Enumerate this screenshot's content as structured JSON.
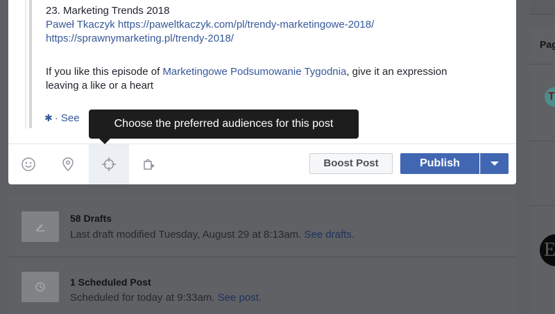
{
  "post": {
    "episode_title": "23. Marketing Trends 2018",
    "link_line_1": "Paweł Tkaczyk https://paweltkaczyk.com/pl/trendy-marketingowe-2018/",
    "link_line_2": "https://sprawnymarketing.pl/trendy-2018/",
    "desc_before": "If you like this episode of ",
    "desc_link": "Marketingowe Podsumowanie Tygodnia",
    "desc_after": ", give it an expression leaving a like or a heart",
    "see_more": "See"
  },
  "tooltip": {
    "text": "Choose the preferred audiences for this post"
  },
  "toolbar": {
    "icons": [
      "smiley-icon",
      "location-pin-icon",
      "target-icon",
      "shopping-bag-icon"
    ],
    "boost_label": "Boost Post",
    "publish_label": "Publish"
  },
  "drafts": {
    "title": "58 Drafts",
    "subtitle": "Last draft modified Tuesday, August 29 at 8:13am.",
    "link": "See drafts."
  },
  "scheduled": {
    "title": "1 Scheduled Post",
    "subtitle": "Scheduled for today at 9:33am.",
    "link": "See post."
  },
  "sidebar": {
    "label": "Pag",
    "avatar_1_letter": "T",
    "avatar_2_letter": "E"
  },
  "colors": {
    "accent": "#4267b2",
    "link": "#365899",
    "overlay": "#5d5f63"
  }
}
